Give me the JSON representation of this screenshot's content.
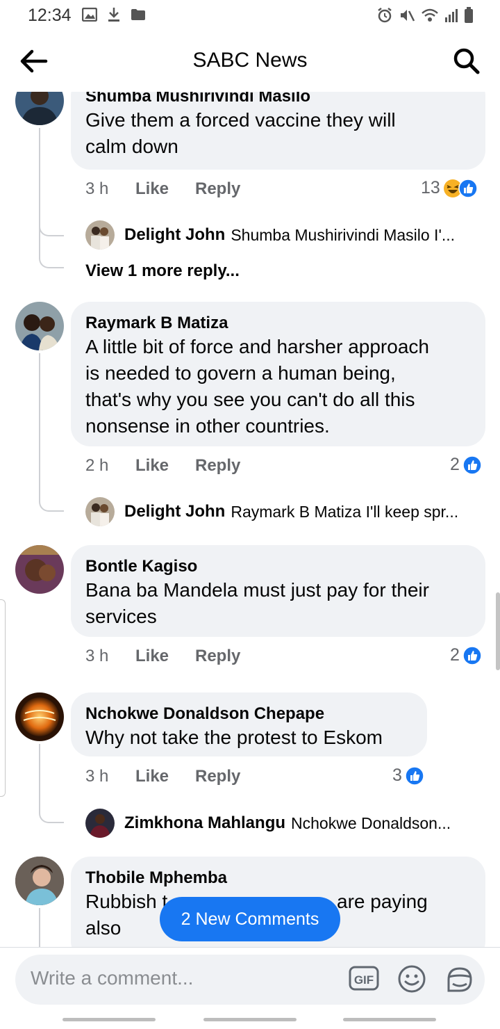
{
  "status_bar": {
    "time": "12:34",
    "left_icons": [
      "gallery-icon",
      "download-icon",
      "folder-icon"
    ],
    "right_icons": [
      "alarm-icon",
      "mute-icon",
      "wifi-icon",
      "signal-icon",
      "battery-icon"
    ]
  },
  "header": {
    "title": "SABC News",
    "back_icon": "arrow-left-icon",
    "search_icon": "search-icon"
  },
  "actions": {
    "like": "Like",
    "reply": "Reply"
  },
  "comments": [
    {
      "author": "Shumba Mushirivindi Masilo",
      "text_lines": [
        "Give them a forced vaccine they  will",
        "calm down"
      ],
      "time": "3 h",
      "reaction_count": "13",
      "reactions": [
        "haha",
        "like"
      ],
      "reply_preview": {
        "name": "Delight John",
        "text": "Shumba Mushirivindi Masilo  I'..."
      },
      "view_more": "View 1 more reply..."
    },
    {
      "author": "Raymark B Matiza",
      "text_lines": [
        "A little bit of force and harsher approach",
        "is needed to govern a human being,",
        "that's why you see you can't do all this",
        "nonsense in other countries."
      ],
      "time": "2 h",
      "reaction_count": "2",
      "reactions": [
        "like"
      ],
      "reply_preview": {
        "name": "Delight John",
        "text": "Raymark B Matiza  I'll keep spr..."
      }
    },
    {
      "author": "Bontle Kagiso",
      "text_lines": [
        "Bana ba Mandela must just pay for their",
        "services"
      ],
      "time": "3 h",
      "reaction_count": "2",
      "reactions": [
        "like"
      ]
    },
    {
      "author": "Nchokwe Donaldson Chepape",
      "text_lines": [
        "Why not take the protest to Eskom"
      ],
      "time": "3 h",
      "reaction_count": "3",
      "reactions": [
        "like"
      ],
      "reply_preview": {
        "name": "Zimkhona Mahlangu",
        "text": "Nchokwe Donaldson..."
      }
    },
    {
      "author": "Thobile Mphemba",
      "text_lines": [
        "Rubbish t",
        "also"
      ],
      "text_line_tail": "are paying"
    }
  ],
  "new_comments_label": "2 New Comments",
  "composer": {
    "placeholder": "Write a comment...",
    "gif_label": "GIF",
    "icons": [
      "gif-icon",
      "emoji-icon",
      "sticker-icon"
    ]
  },
  "colors": {
    "accent": "#1877f2",
    "bubble": "#f0f2f5",
    "muted": "#65676b"
  }
}
